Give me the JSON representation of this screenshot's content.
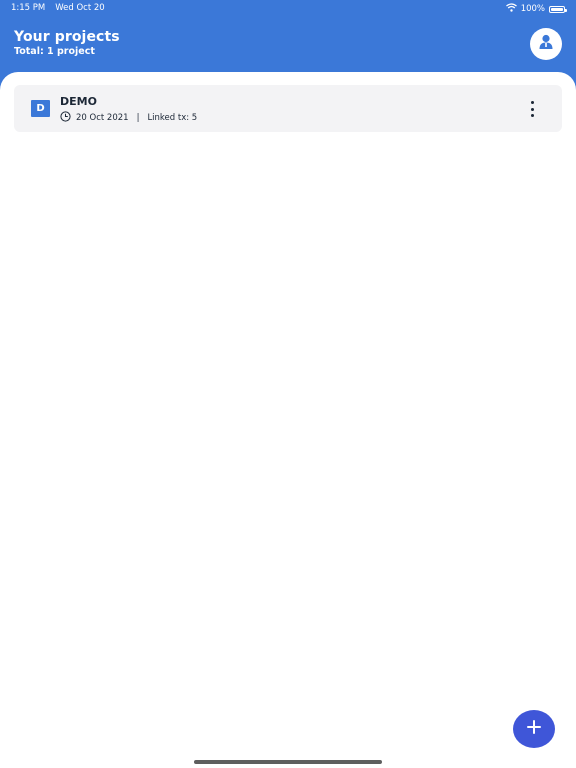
{
  "status_bar": {
    "time": "1:15 PM",
    "date": "Wed Oct 20",
    "battery": "100%",
    "icons": [
      "wifi-icon",
      "battery-icon"
    ]
  },
  "header": {
    "title": "Your projects",
    "subtitle": "Total: 1 project",
    "profile_icon": "user-profile-icon"
  },
  "projects": [
    {
      "initial": "D",
      "name": "DEMO",
      "date": "20 Oct 2021",
      "separator": "|",
      "linked": "Linked tx: 5",
      "icons": [
        "clock-icon",
        "more-vertical-icon"
      ]
    }
  ],
  "fab": {
    "icon": "plus-icon"
  },
  "colors": {
    "brand": "#3b78d8",
    "fab": "#3f56d8",
    "card": "#f3f3f5",
    "text": "#1c2736"
  }
}
